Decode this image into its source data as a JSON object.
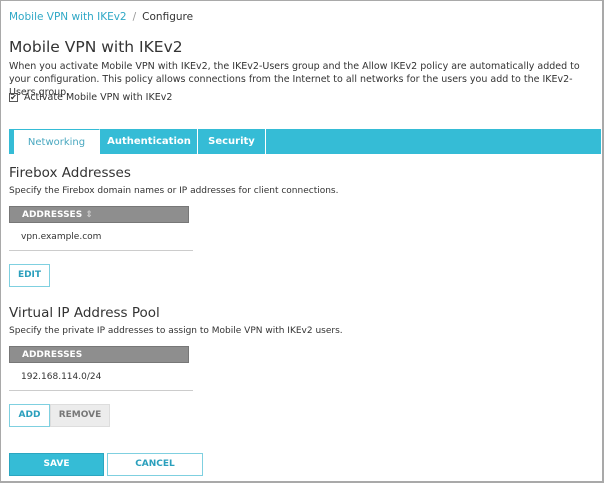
{
  "breadcrumb": {
    "parent": "Mobile VPN with IKEv2",
    "separator": "/",
    "current": "Configure"
  },
  "title": "Mobile VPN with IKEv2",
  "intro": "When you activate Mobile VPN with IKEv2, the IKEv2-Users group and the Allow IKEv2 policy are automatically added to your configuration. This policy allows connections from the Internet to all networks for the users you add to the IKEv2-Users group.",
  "activate": {
    "label": "Activate Mobile VPN with IKEv2",
    "checked": true,
    "mark": "✔"
  },
  "tabs": [
    {
      "label": "Networking",
      "active": true
    },
    {
      "label": "Authentication"
    },
    {
      "label": "Security"
    }
  ],
  "firebox": {
    "heading": "Firebox Addresses",
    "description": "Specify the Firebox domain names or IP addresses for client connections.",
    "column": "ADDRESSES",
    "sort_icon": "⇕",
    "rows": [
      "vpn.example.com"
    ],
    "edit_label": "EDIT"
  },
  "pool": {
    "heading": "Virtual IP Address Pool",
    "description": "Specify the private IP addresses to assign to Mobile VPN with IKEv2 users.",
    "column": "ADDRESSES",
    "rows": [
      "192.168.114.0/24"
    ],
    "add_label": "ADD",
    "remove_label": "REMOVE"
  },
  "footer": {
    "save_label": "SAVE",
    "cancel_label": "CANCEL"
  }
}
